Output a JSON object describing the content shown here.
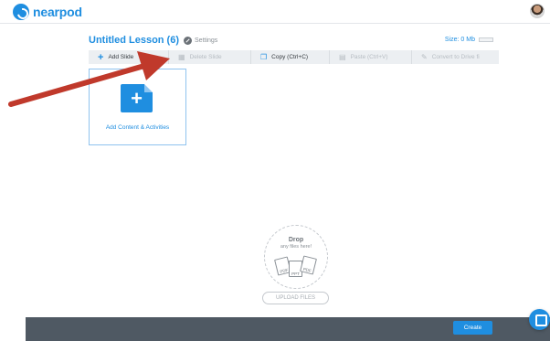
{
  "app": {
    "logo_text": "nearpod",
    "accent_color": "#1f8ee0"
  },
  "lesson": {
    "title": "Untitled Lesson (6)",
    "settings_label": "Settings",
    "size_label": "Size: 0 Mb"
  },
  "toolbar": {
    "add_label": "Add Slide",
    "delete_label": "Delete Slide",
    "copy_label": "Copy (Ctrl+C)",
    "paste_label": "Paste (Ctrl+V)",
    "convert_label": "Convert to Drive fi"
  },
  "card": {
    "add_content_label": "Add Content & Activities"
  },
  "dropzone": {
    "title": "Drop",
    "subtitle": "any files here!",
    "file_types": [
      "PDF",
      "PPT",
      "PDF"
    ],
    "upload_label": "UPLOAD FILES"
  },
  "footer": {
    "create_label": "Create"
  },
  "annotation": {
    "arrow_color": "#c0392b"
  }
}
